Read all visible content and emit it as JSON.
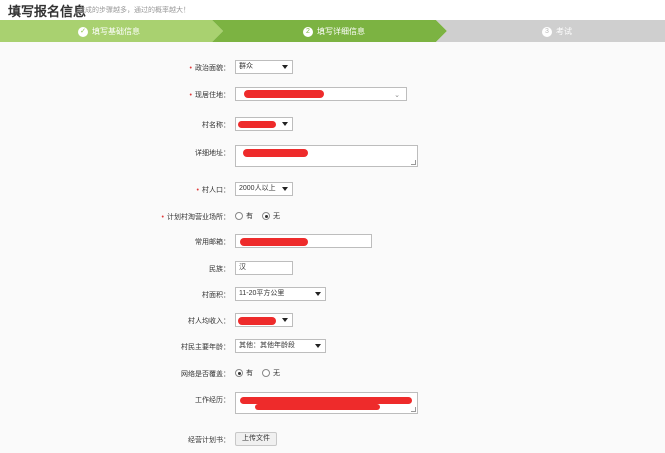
{
  "header": {
    "title": "填写报名信息",
    "subtitle": "完成的步骤越多，通过的概率越大！"
  },
  "steps": [
    {
      "num": "✓",
      "label": "填写基础信息",
      "state": "done"
    },
    {
      "num": "2",
      "label": "填写详细信息",
      "state": "active"
    },
    {
      "num": "3",
      "label": "考试",
      "state": "pending"
    }
  ],
  "colors": {
    "step_done": "#a9d170",
    "step_active": "#7cb342",
    "step_pending": "#cfcfcf",
    "required": "#e03a3a",
    "redaction": "#ee2b2b"
  },
  "form": {
    "political": {
      "label": "政治面貌：",
      "value": "群众"
    },
    "residence": {
      "label": "现居住地：",
      "value": ""
    },
    "village": {
      "label": "村名称：",
      "value": ""
    },
    "address": {
      "label": "详细地址：",
      "value": ""
    },
    "population": {
      "label": "村人口：",
      "value": "2000人以上"
    },
    "venue": {
      "label": "计划村淘营业场所：",
      "opt_yes": "有",
      "opt_no": "无"
    },
    "email": {
      "label": "常用邮箱：",
      "value": ""
    },
    "ethnicity": {
      "label": "民族：",
      "value": "汉"
    },
    "area": {
      "label": "村面积：",
      "value": "11-20平方公里"
    },
    "income": {
      "label": "村人均收入：",
      "value": ""
    },
    "age": {
      "label": "村民主要年龄：",
      "value": "其他：其他年龄段"
    },
    "network": {
      "label": "网络是否覆盖：",
      "opt_yes": "有",
      "opt_no": "无"
    },
    "experience": {
      "label": "工作经历：",
      "value": ""
    },
    "plan": {
      "label": "经营计划书：",
      "button": "上传文件"
    }
  }
}
